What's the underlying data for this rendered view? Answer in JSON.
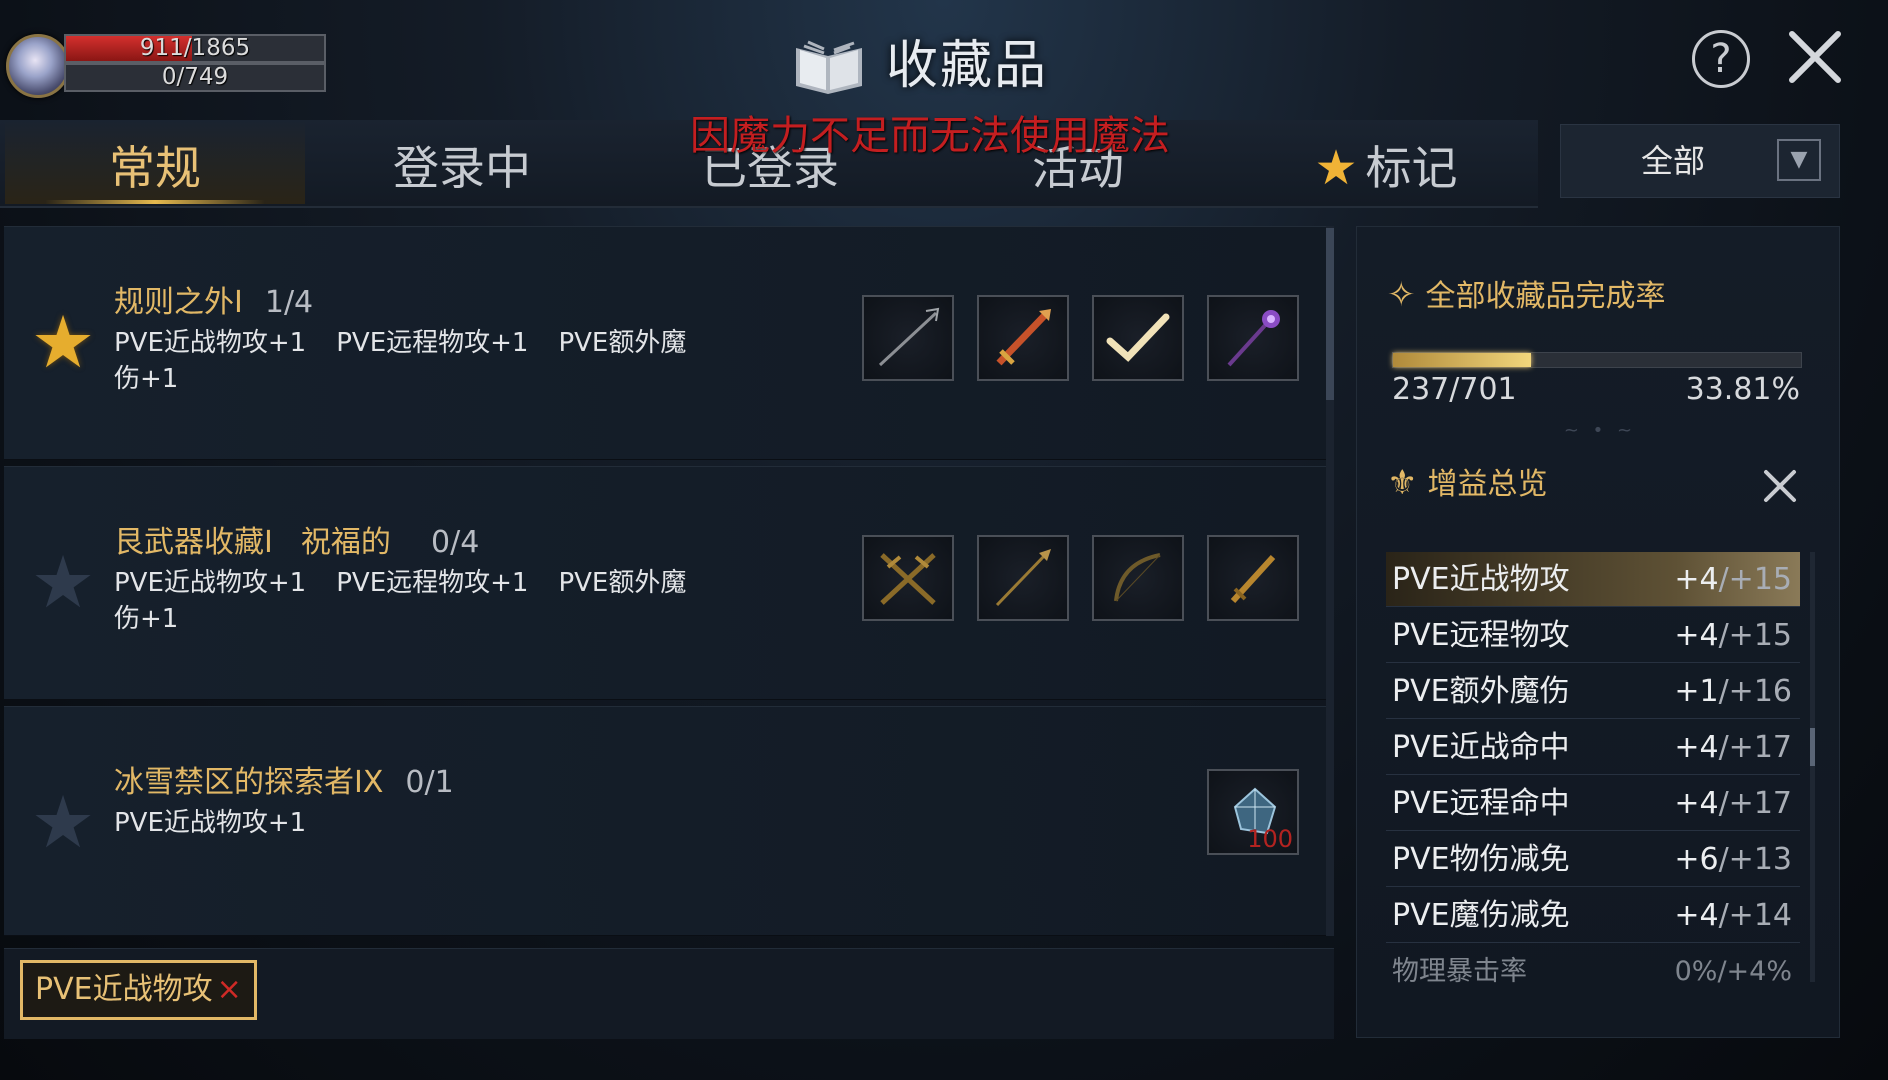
{
  "player": {
    "hp_text": "911/1865",
    "hp_fraction": 0.488,
    "mp_text": "0/749",
    "mp_fraction": 0.0
  },
  "header": {
    "title": "收藏品",
    "warning": "因魔力不足而无法使用魔法",
    "help_icon": "?",
    "close_icon": "close-icon"
  },
  "tabs": [
    {
      "label": "常规",
      "active": true
    },
    {
      "label": "登录中"
    },
    {
      "label": "已登录"
    },
    {
      "label": "活动"
    },
    {
      "label": "标记",
      "icon": "★"
    }
  ],
  "filter": {
    "label": "全部",
    "arrow": "▼"
  },
  "collections": [
    {
      "title": "规则之外I",
      "progress": "1/4",
      "favorite": true,
      "effects": [
        "PVE近战物攻+1",
        "PVE远程物攻+1",
        "PVE额外魔",
        "伤+1"
      ]
    },
    {
      "title": "艮武器收藏I",
      "subtitle": "祝福的",
      "progress": "0/4",
      "favorite": false,
      "effects": [
        "PVE近战物攻+1",
        "PVE远程物攻+1",
        "PVE额外魔",
        "伤+1"
      ]
    },
    {
      "title": "冰雪禁区的探索者IX",
      "progress": "0/1",
      "favorite": false,
      "effects": [
        "PVE近战物攻+1"
      ],
      "item_badge": "100"
    }
  ],
  "active_filter_chip": {
    "label": "PVE近战物攻",
    "remove": "×"
  },
  "completion": {
    "heading": "全部收藏品完成率",
    "count": "237/701",
    "rate": "33.81%",
    "fraction": 0.338
  },
  "buffs": {
    "heading": "增益总览",
    "items": [
      {
        "name": "PVE近战物攻",
        "current": "+4",
        "max": "/+15"
      },
      {
        "name": "PVE远程物攻",
        "current": "+4",
        "max": "/+15"
      },
      {
        "name": "PVE额外魔伤",
        "current": "+1",
        "max": "/+16"
      },
      {
        "name": "PVE近战命中",
        "current": "+4",
        "max": "/+17"
      },
      {
        "name": "PVE远程命中",
        "current": "+4",
        "max": "/+17"
      },
      {
        "name": "PVE物伤减免",
        "current": "+6",
        "max": "/+13"
      },
      {
        "name": "PVE魔伤减免",
        "current": "+4",
        "max": "/+14"
      },
      {
        "name": "物理暴击率",
        "current": "0%",
        "max": "/+4%"
      }
    ]
  },
  "colors": {
    "gold": "#e2b866",
    "warning": "#c41e20",
    "hp": "#d4302e"
  }
}
